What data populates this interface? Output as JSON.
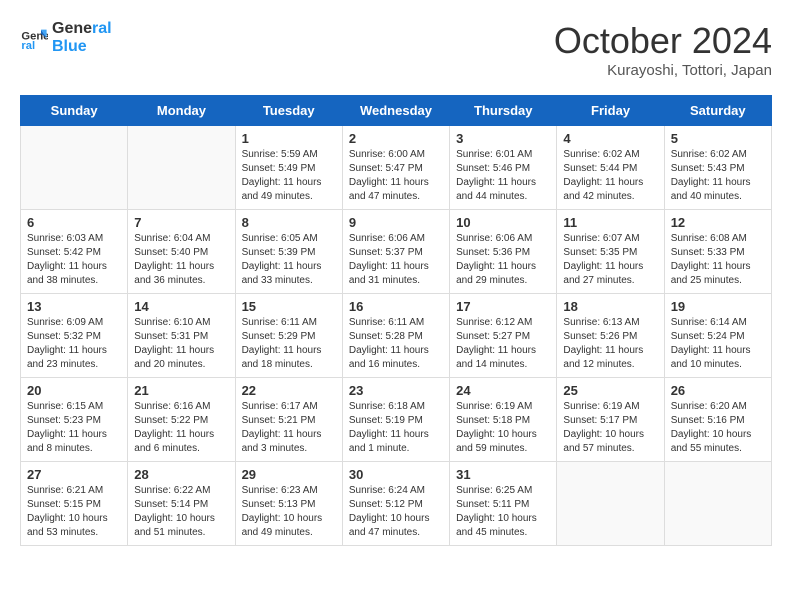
{
  "header": {
    "logo_line1": "General",
    "logo_line2": "Blue",
    "month": "October 2024",
    "location": "Kurayoshi, Tottori, Japan"
  },
  "days_of_week": [
    "Sunday",
    "Monday",
    "Tuesday",
    "Wednesday",
    "Thursday",
    "Friday",
    "Saturday"
  ],
  "weeks": [
    [
      {
        "day": "",
        "info": ""
      },
      {
        "day": "",
        "info": ""
      },
      {
        "day": "1",
        "info": "Sunrise: 5:59 AM\nSunset: 5:49 PM\nDaylight: 11 hours and 49 minutes."
      },
      {
        "day": "2",
        "info": "Sunrise: 6:00 AM\nSunset: 5:47 PM\nDaylight: 11 hours and 47 minutes."
      },
      {
        "day": "3",
        "info": "Sunrise: 6:01 AM\nSunset: 5:46 PM\nDaylight: 11 hours and 44 minutes."
      },
      {
        "day": "4",
        "info": "Sunrise: 6:02 AM\nSunset: 5:44 PM\nDaylight: 11 hours and 42 minutes."
      },
      {
        "day": "5",
        "info": "Sunrise: 6:02 AM\nSunset: 5:43 PM\nDaylight: 11 hours and 40 minutes."
      }
    ],
    [
      {
        "day": "6",
        "info": "Sunrise: 6:03 AM\nSunset: 5:42 PM\nDaylight: 11 hours and 38 minutes."
      },
      {
        "day": "7",
        "info": "Sunrise: 6:04 AM\nSunset: 5:40 PM\nDaylight: 11 hours and 36 minutes."
      },
      {
        "day": "8",
        "info": "Sunrise: 6:05 AM\nSunset: 5:39 PM\nDaylight: 11 hours and 33 minutes."
      },
      {
        "day": "9",
        "info": "Sunrise: 6:06 AM\nSunset: 5:37 PM\nDaylight: 11 hours and 31 minutes."
      },
      {
        "day": "10",
        "info": "Sunrise: 6:06 AM\nSunset: 5:36 PM\nDaylight: 11 hours and 29 minutes."
      },
      {
        "day": "11",
        "info": "Sunrise: 6:07 AM\nSunset: 5:35 PM\nDaylight: 11 hours and 27 minutes."
      },
      {
        "day": "12",
        "info": "Sunrise: 6:08 AM\nSunset: 5:33 PM\nDaylight: 11 hours and 25 minutes."
      }
    ],
    [
      {
        "day": "13",
        "info": "Sunrise: 6:09 AM\nSunset: 5:32 PM\nDaylight: 11 hours and 23 minutes."
      },
      {
        "day": "14",
        "info": "Sunrise: 6:10 AM\nSunset: 5:31 PM\nDaylight: 11 hours and 20 minutes."
      },
      {
        "day": "15",
        "info": "Sunrise: 6:11 AM\nSunset: 5:29 PM\nDaylight: 11 hours and 18 minutes."
      },
      {
        "day": "16",
        "info": "Sunrise: 6:11 AM\nSunset: 5:28 PM\nDaylight: 11 hours and 16 minutes."
      },
      {
        "day": "17",
        "info": "Sunrise: 6:12 AM\nSunset: 5:27 PM\nDaylight: 11 hours and 14 minutes."
      },
      {
        "day": "18",
        "info": "Sunrise: 6:13 AM\nSunset: 5:26 PM\nDaylight: 11 hours and 12 minutes."
      },
      {
        "day": "19",
        "info": "Sunrise: 6:14 AM\nSunset: 5:24 PM\nDaylight: 11 hours and 10 minutes."
      }
    ],
    [
      {
        "day": "20",
        "info": "Sunrise: 6:15 AM\nSunset: 5:23 PM\nDaylight: 11 hours and 8 minutes."
      },
      {
        "day": "21",
        "info": "Sunrise: 6:16 AM\nSunset: 5:22 PM\nDaylight: 11 hours and 6 minutes."
      },
      {
        "day": "22",
        "info": "Sunrise: 6:17 AM\nSunset: 5:21 PM\nDaylight: 11 hours and 3 minutes."
      },
      {
        "day": "23",
        "info": "Sunrise: 6:18 AM\nSunset: 5:19 PM\nDaylight: 11 hours and 1 minute."
      },
      {
        "day": "24",
        "info": "Sunrise: 6:19 AM\nSunset: 5:18 PM\nDaylight: 10 hours and 59 minutes."
      },
      {
        "day": "25",
        "info": "Sunrise: 6:19 AM\nSunset: 5:17 PM\nDaylight: 10 hours and 57 minutes."
      },
      {
        "day": "26",
        "info": "Sunrise: 6:20 AM\nSunset: 5:16 PM\nDaylight: 10 hours and 55 minutes."
      }
    ],
    [
      {
        "day": "27",
        "info": "Sunrise: 6:21 AM\nSunset: 5:15 PM\nDaylight: 10 hours and 53 minutes."
      },
      {
        "day": "28",
        "info": "Sunrise: 6:22 AM\nSunset: 5:14 PM\nDaylight: 10 hours and 51 minutes."
      },
      {
        "day": "29",
        "info": "Sunrise: 6:23 AM\nSunset: 5:13 PM\nDaylight: 10 hours and 49 minutes."
      },
      {
        "day": "30",
        "info": "Sunrise: 6:24 AM\nSunset: 5:12 PM\nDaylight: 10 hours and 47 minutes."
      },
      {
        "day": "31",
        "info": "Sunrise: 6:25 AM\nSunset: 5:11 PM\nDaylight: 10 hours and 45 minutes."
      },
      {
        "day": "",
        "info": ""
      },
      {
        "day": "",
        "info": ""
      }
    ]
  ]
}
